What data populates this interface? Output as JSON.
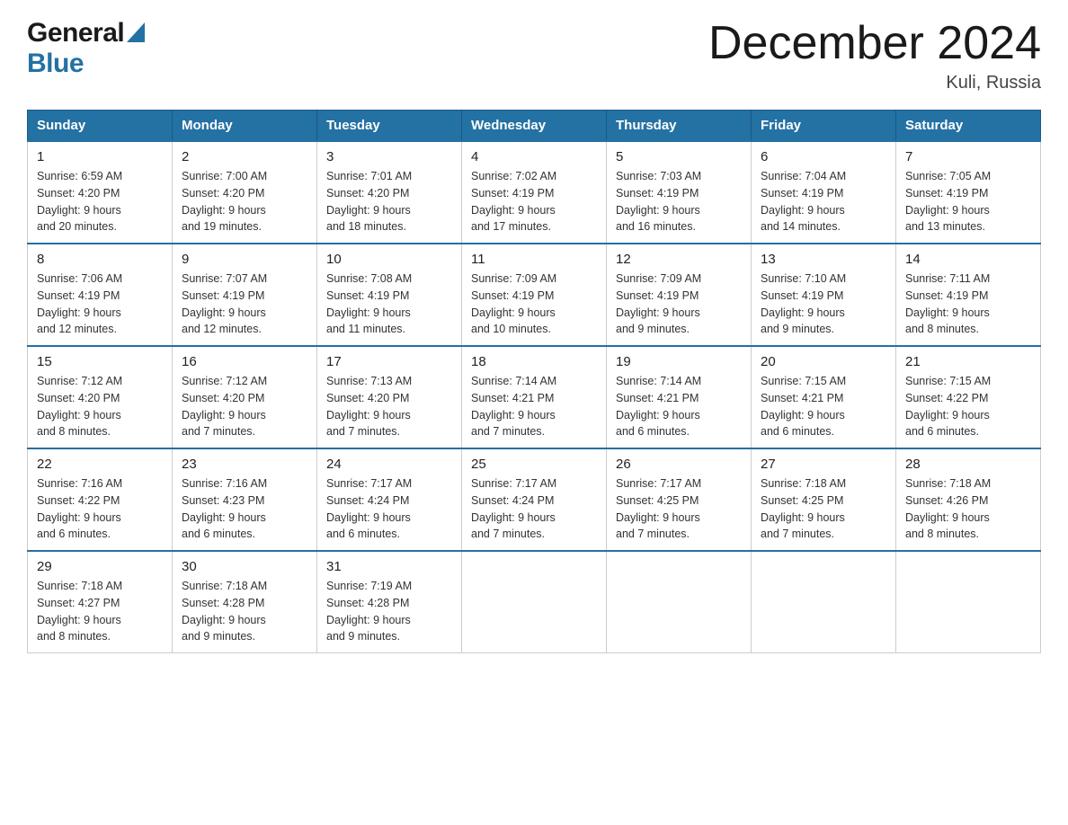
{
  "header": {
    "logo_general": "General",
    "logo_blue": "Blue",
    "title": "December 2024",
    "subtitle": "Kuli, Russia"
  },
  "columns": [
    "Sunday",
    "Monday",
    "Tuesday",
    "Wednesday",
    "Thursday",
    "Friday",
    "Saturday"
  ],
  "weeks": [
    [
      {
        "day": "1",
        "sunrise": "6:59 AM",
        "sunset": "4:20 PM",
        "daylight": "9 hours and 20 minutes."
      },
      {
        "day": "2",
        "sunrise": "7:00 AM",
        "sunset": "4:20 PM",
        "daylight": "9 hours and 19 minutes."
      },
      {
        "day": "3",
        "sunrise": "7:01 AM",
        "sunset": "4:20 PM",
        "daylight": "9 hours and 18 minutes."
      },
      {
        "day": "4",
        "sunrise": "7:02 AM",
        "sunset": "4:19 PM",
        "daylight": "9 hours and 17 minutes."
      },
      {
        "day": "5",
        "sunrise": "7:03 AM",
        "sunset": "4:19 PM",
        "daylight": "9 hours and 16 minutes."
      },
      {
        "day": "6",
        "sunrise": "7:04 AM",
        "sunset": "4:19 PM",
        "daylight": "9 hours and 14 minutes."
      },
      {
        "day": "7",
        "sunrise": "7:05 AM",
        "sunset": "4:19 PM",
        "daylight": "9 hours and 13 minutes."
      }
    ],
    [
      {
        "day": "8",
        "sunrise": "7:06 AM",
        "sunset": "4:19 PM",
        "daylight": "9 hours and 12 minutes."
      },
      {
        "day": "9",
        "sunrise": "7:07 AM",
        "sunset": "4:19 PM",
        "daylight": "9 hours and 12 minutes."
      },
      {
        "day": "10",
        "sunrise": "7:08 AM",
        "sunset": "4:19 PM",
        "daylight": "9 hours and 11 minutes."
      },
      {
        "day": "11",
        "sunrise": "7:09 AM",
        "sunset": "4:19 PM",
        "daylight": "9 hours and 10 minutes."
      },
      {
        "day": "12",
        "sunrise": "7:09 AM",
        "sunset": "4:19 PM",
        "daylight": "9 hours and 9 minutes."
      },
      {
        "day": "13",
        "sunrise": "7:10 AM",
        "sunset": "4:19 PM",
        "daylight": "9 hours and 9 minutes."
      },
      {
        "day": "14",
        "sunrise": "7:11 AM",
        "sunset": "4:19 PM",
        "daylight": "9 hours and 8 minutes."
      }
    ],
    [
      {
        "day": "15",
        "sunrise": "7:12 AM",
        "sunset": "4:20 PM",
        "daylight": "9 hours and 8 minutes."
      },
      {
        "day": "16",
        "sunrise": "7:12 AM",
        "sunset": "4:20 PM",
        "daylight": "9 hours and 7 minutes."
      },
      {
        "day": "17",
        "sunrise": "7:13 AM",
        "sunset": "4:20 PM",
        "daylight": "9 hours and 7 minutes."
      },
      {
        "day": "18",
        "sunrise": "7:14 AM",
        "sunset": "4:21 PM",
        "daylight": "9 hours and 7 minutes."
      },
      {
        "day": "19",
        "sunrise": "7:14 AM",
        "sunset": "4:21 PM",
        "daylight": "9 hours and 6 minutes."
      },
      {
        "day": "20",
        "sunrise": "7:15 AM",
        "sunset": "4:21 PM",
        "daylight": "9 hours and 6 minutes."
      },
      {
        "day": "21",
        "sunrise": "7:15 AM",
        "sunset": "4:22 PM",
        "daylight": "9 hours and 6 minutes."
      }
    ],
    [
      {
        "day": "22",
        "sunrise": "7:16 AM",
        "sunset": "4:22 PM",
        "daylight": "9 hours and 6 minutes."
      },
      {
        "day": "23",
        "sunrise": "7:16 AM",
        "sunset": "4:23 PM",
        "daylight": "9 hours and 6 minutes."
      },
      {
        "day": "24",
        "sunrise": "7:17 AM",
        "sunset": "4:24 PM",
        "daylight": "9 hours and 6 minutes."
      },
      {
        "day": "25",
        "sunrise": "7:17 AM",
        "sunset": "4:24 PM",
        "daylight": "9 hours and 7 minutes."
      },
      {
        "day": "26",
        "sunrise": "7:17 AM",
        "sunset": "4:25 PM",
        "daylight": "9 hours and 7 minutes."
      },
      {
        "day": "27",
        "sunrise": "7:18 AM",
        "sunset": "4:25 PM",
        "daylight": "9 hours and 7 minutes."
      },
      {
        "day": "28",
        "sunrise": "7:18 AM",
        "sunset": "4:26 PM",
        "daylight": "9 hours and 8 minutes."
      }
    ],
    [
      {
        "day": "29",
        "sunrise": "7:18 AM",
        "sunset": "4:27 PM",
        "daylight": "9 hours and 8 minutes."
      },
      {
        "day": "30",
        "sunrise": "7:18 AM",
        "sunset": "4:28 PM",
        "daylight": "9 hours and 9 minutes."
      },
      {
        "day": "31",
        "sunrise": "7:19 AM",
        "sunset": "4:28 PM",
        "daylight": "9 hours and 9 minutes."
      },
      null,
      null,
      null,
      null
    ]
  ],
  "labels": {
    "sunrise_prefix": "Sunrise: ",
    "sunset_prefix": "Sunset: ",
    "daylight_prefix": "Daylight: "
  }
}
